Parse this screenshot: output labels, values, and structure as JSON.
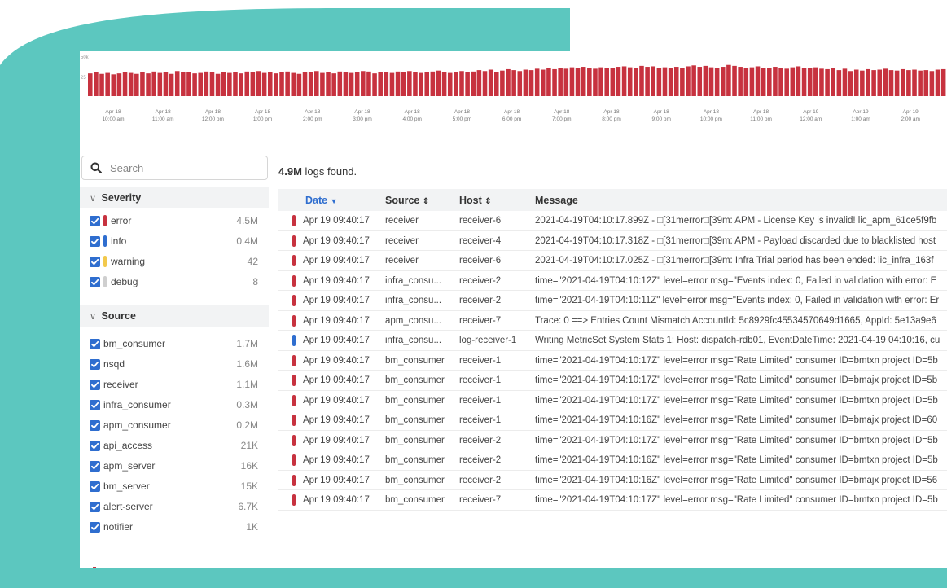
{
  "colors": {
    "accent": "#2f6ecf",
    "error": "#c7323f",
    "info": "#2f6ecf",
    "warning": "#f2c94c",
    "debug": "#cfcfcf",
    "teal_background": "#5cc7bf"
  },
  "histogram": {
    "y_max_label": "50k",
    "y_mid_label": "25",
    "ticks": [
      {
        "date": "Apr 18",
        "time": "10:00 am"
      },
      {
        "date": "Apr 18",
        "time": "11:00 am"
      },
      {
        "date": "Apr 18",
        "time": "12:00 pm"
      },
      {
        "date": "Apr 18",
        "time": "1:00 pm"
      },
      {
        "date": "Apr 18",
        "time": "2:00 pm"
      },
      {
        "date": "Apr 18",
        "time": "3:00 pm"
      },
      {
        "date": "Apr 18",
        "time": "4:00 pm"
      },
      {
        "date": "Apr 18",
        "time": "5:00 pm"
      },
      {
        "date": "Apr 18",
        "time": "6:00 pm"
      },
      {
        "date": "Apr 18",
        "time": "7:00 pm"
      },
      {
        "date": "Apr 18",
        "time": "8:00 pm"
      },
      {
        "date": "Apr 18",
        "time": "9:00 pm"
      },
      {
        "date": "Apr 18",
        "time": "10:00 pm"
      },
      {
        "date": "Apr 18",
        "time": "11:00 pm"
      },
      {
        "date": "Apr 19",
        "time": "12:00 am"
      },
      {
        "date": "Apr 19",
        "time": "1:00 am"
      },
      {
        "date": "Apr 19",
        "time": "2:00 am"
      }
    ],
    "bar_fractions": [
      0.48,
      0.5,
      0.47,
      0.49,
      0.46,
      0.48,
      0.5,
      0.49,
      0.47,
      0.51,
      0.48,
      0.52,
      0.49,
      0.5,
      0.47,
      0.53,
      0.51,
      0.5,
      0.48,
      0.49,
      0.52,
      0.5,
      0.47,
      0.5,
      0.49,
      0.51,
      0.48,
      0.52,
      0.5,
      0.53,
      0.49,
      0.51,
      0.48,
      0.5,
      0.52,
      0.49,
      0.47,
      0.5,
      0.51,
      0.53,
      0.49,
      0.5,
      0.48,
      0.52,
      0.51,
      0.49,
      0.5,
      0.53,
      0.52,
      0.48,
      0.5,
      0.51,
      0.49,
      0.52,
      0.5,
      0.53,
      0.51,
      0.49,
      0.5,
      0.52,
      0.54,
      0.5,
      0.49,
      0.51,
      0.53,
      0.5,
      0.52,
      0.55,
      0.53,
      0.56,
      0.51,
      0.54,
      0.57,
      0.55,
      0.53,
      0.56,
      0.55,
      0.58,
      0.56,
      0.59,
      0.57,
      0.6,
      0.58,
      0.61,
      0.59,
      0.62,
      0.6,
      0.58,
      0.61,
      0.59,
      0.6,
      0.62,
      0.63,
      0.61,
      0.6,
      0.64,
      0.62,
      0.63,
      0.6,
      0.61,
      0.59,
      0.62,
      0.6,
      0.63,
      0.65,
      0.62,
      0.64,
      0.61,
      0.6,
      0.62,
      0.66,
      0.64,
      0.62,
      0.6,
      0.61,
      0.63,
      0.6,
      0.59,
      0.62,
      0.6,
      0.58,
      0.61,
      0.63,
      0.6,
      0.59,
      0.61,
      0.58,
      0.57,
      0.6,
      0.55,
      0.58,
      0.53,
      0.56,
      0.54,
      0.57,
      0.55,
      0.56,
      0.58,
      0.55,
      0.54,
      0.57,
      0.55,
      0.56,
      0.54,
      0.55,
      0.53,
      0.56,
      0.57
    ]
  },
  "search": {
    "placeholder": "Search"
  },
  "facets": {
    "severity": {
      "title": "Severity",
      "items": [
        {
          "label": "error",
          "count": "4.5M",
          "color": "#c7323f"
        },
        {
          "label": "info",
          "count": "0.4M",
          "color": "#2f6ecf"
        },
        {
          "label": "warning",
          "count": "42",
          "color": "#f2c94c"
        },
        {
          "label": "debug",
          "count": "8",
          "color": "#cfcfcf"
        }
      ]
    },
    "source": {
      "title": "Source",
      "items": [
        {
          "label": "bm_consumer",
          "count": "1.7M"
        },
        {
          "label": "nsqd",
          "count": "1.6M"
        },
        {
          "label": "receiver",
          "count": "1.1M"
        },
        {
          "label": "infra_consumer",
          "count": "0.3M"
        },
        {
          "label": "apm_consumer",
          "count": "0.2M"
        },
        {
          "label": "api_access",
          "count": "21K"
        },
        {
          "label": "apm_server",
          "count": "16K"
        },
        {
          "label": "bm_server",
          "count": "15K"
        },
        {
          "label": "alert-server",
          "count": "6.7K"
        },
        {
          "label": "notifier",
          "count": "1K"
        }
      ]
    }
  },
  "results": {
    "count": "4.9M",
    "suffix": "logs found."
  },
  "table": {
    "headers": {
      "date": "Date",
      "source": "Source",
      "host": "Host",
      "message": "Message"
    },
    "rows": [
      {
        "level": "error",
        "date": "Apr 19 09:40:17",
        "source": "receiver",
        "host": "receiver-6",
        "message": "2021-04-19T04:10:17.899Z - □[31merror□[39m: APM - License Key is invalid! lic_apm_61ce5f9fb"
      },
      {
        "level": "error",
        "date": "Apr 19 09:40:17",
        "source": "receiver",
        "host": "receiver-4",
        "message": "2021-04-19T04:10:17.318Z - □[31merror□[39m: APM - Payload discarded due to blacklisted host"
      },
      {
        "level": "error",
        "date": "Apr 19 09:40:17",
        "source": "receiver",
        "host": "receiver-6",
        "message": "2021-04-19T04:10:17.025Z - □[31merror□[39m: Infra Trial period has been ended: lic_infra_163f"
      },
      {
        "level": "error",
        "date": "Apr 19 09:40:17",
        "source": "infra_consu...",
        "host": "receiver-2",
        "message": "time=\"2021-04-19T04:10:12Z\" level=error msg=\"Events index: 0, Failed in validation with error: E"
      },
      {
        "level": "error",
        "date": "Apr 19 09:40:17",
        "source": "infra_consu...",
        "host": "receiver-2",
        "message": "time=\"2021-04-19T04:10:11Z\" level=error msg=\"Events index: 0, Failed in validation with error: Er"
      },
      {
        "level": "error",
        "date": "Apr 19 09:40:17",
        "source": "apm_consu...",
        "host": "receiver-7",
        "message": "Trace: 0 ==> Entries Count Mismatch AccountId: 5c8929fc45534570649d1665, AppId: 5e13a9e6"
      },
      {
        "level": "info",
        "date": "Apr 19 09:40:17",
        "source": "infra_consu...",
        "host": "log-receiver-1",
        "message": "Writing MetricSet System Stats 1: Host: dispatch-rdb01, EventDateTime: 2021-04-19 04:10:16, cu"
      },
      {
        "level": "error",
        "date": "Apr 19 09:40:17",
        "source": "bm_consumer",
        "host": "receiver-1",
        "message": "time=\"2021-04-19T04:10:17Z\" level=error msg=\"Rate Limited\" consumer ID=bmtxn project ID=5b"
      },
      {
        "level": "error",
        "date": "Apr 19 09:40:17",
        "source": "bm_consumer",
        "host": "receiver-1",
        "message": "time=\"2021-04-19T04:10:17Z\" level=error msg=\"Rate Limited\" consumer ID=bmajx project ID=5b"
      },
      {
        "level": "error",
        "date": "Apr 19 09:40:17",
        "source": "bm_consumer",
        "host": "receiver-1",
        "message": "time=\"2021-04-19T04:10:17Z\" level=error msg=\"Rate Limited\" consumer ID=bmtxn project ID=5b"
      },
      {
        "level": "error",
        "date": "Apr 19 09:40:17",
        "source": "bm_consumer",
        "host": "receiver-1",
        "message": "time=\"2021-04-19T04:10:16Z\" level=error msg=\"Rate Limited\" consumer ID=bmajx project ID=60"
      },
      {
        "level": "error",
        "date": "Apr 19 09:40:17",
        "source": "bm_consumer",
        "host": "receiver-2",
        "message": "time=\"2021-04-19T04:10:17Z\" level=error msg=\"Rate Limited\" consumer ID=bmtxn project ID=5b"
      },
      {
        "level": "error",
        "date": "Apr 19 09:40:17",
        "source": "bm_consumer",
        "host": "receiver-2",
        "message": "time=\"2021-04-19T04:10:16Z\" level=error msg=\"Rate Limited\" consumer ID=bmtxn project ID=5b"
      },
      {
        "level": "error",
        "date": "Apr 19 09:40:17",
        "source": "bm_consumer",
        "host": "receiver-2",
        "message": "time=\"2021-04-19T04:10:16Z\" level=error msg=\"Rate Limited\" consumer ID=bmajx project ID=56"
      },
      {
        "level": "error",
        "date": "Apr 19 09:40:17",
        "source": "bm_consumer",
        "host": "receiver-7",
        "message": "time=\"2021-04-19T04:10:17Z\" level=error msg=\"Rate Limited\" consumer ID=bmtxn project ID=5b"
      }
    ]
  }
}
